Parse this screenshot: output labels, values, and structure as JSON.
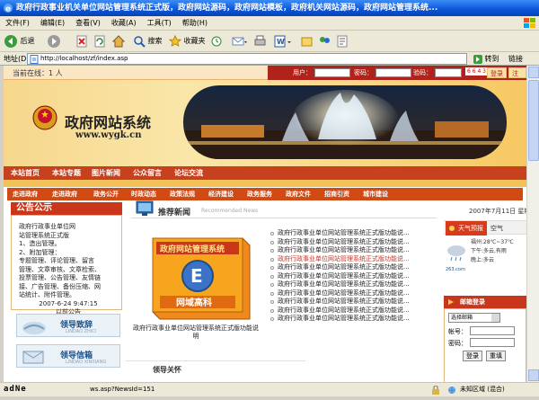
{
  "window": {
    "title": "政府行政事业机关单位网站管理系统正式版，政府网站源码，政府网站模板，政府机关网站源码，政府网站管理系统..."
  },
  "menu": [
    "文件(F)",
    "编辑(E)",
    "查看(V)",
    "收藏(A)",
    "工具(T)",
    "帮助(H)"
  ],
  "toolbar": {
    "back": "后退",
    "search": "搜索",
    "favorites": "收藏夹"
  },
  "address": {
    "label": "地址(D)",
    "url": "http://localhost/zf/index.asp",
    "go": "转到",
    "links": "链接"
  },
  "status": {
    "text": "ws.asp?NewsId=151",
    "zone": "未知区域 (混合)"
  },
  "page": {
    "online_label": "当前在线：1 人",
    "login": {
      "user_label": "用户：",
      "pass_label": "密码：",
      "code_label": "验码：",
      "code_value": "6 6 4 3",
      "login_btn": "登录",
      "register_btn": "注册"
    },
    "banner": {
      "title": "政府网站系统",
      "url": "www.wygk.cn"
    },
    "nav1": [
      "本站首页",
      "本站专题",
      "图片新闻",
      "公众留言",
      "论坛交流"
    ],
    "nav3": [
      "走进政府",
      "走进政府",
      "政务公开",
      "时政动态",
      "政策法规",
      "经济建设",
      "政务服务",
      "政府文件",
      "招商引资",
      "城市建设"
    ],
    "notice": {
      "title": "公告公示",
      "lines": [
        "政府行政事业单位网",
        "站管理系统正式版",
        "1、造出管理。",
        "2、附加管理：",
        "专题管理、评论管理、留言",
        "管理、文章审核、文章检索、",
        "投票管理、公告管理、友情链",
        "接、广告管理、备份压缩、网",
        "站统计、附件管理。",
        "2007-6-24 9:47:15",
        "以前公告"
      ]
    },
    "lead1": {
      "label": "领导致辞",
      "en": "LINDAO ZHICI"
    },
    "lead2": {
      "label": "领导信箱",
      "en": "LINDAO XINXIANG"
    },
    "featured": {
      "title": "推荐新闻",
      "en": "Recommended News",
      "product_title": "政府网站管理系统",
      "product_sub": "网域高科",
      "caption": "政府行政事业单位网站管理系统正式版功能说明"
    },
    "news": [
      "政府行政事业单位网站管理系统正式版功能说...",
      "政府行政事业单位网站管理系统正式版功能说...",
      "政府行政事业单位网站管理系统正式版功能说...",
      "政府行政事业单位网站管理系统正式版功能说...",
      "政府行政事业单位网站管理系统正式版功能说...",
      "政府行政事业单位网站管理系统正式版功能说...",
      "政府行政事业单位网站管理系统正式版功能说...",
      "政府行政事业单位网站管理系统正式版功能说...",
      "政府行政事业单位网站管理系统正式版功能说...",
      "政府行政事业单位网站管理系统正式版功能说...",
      "政府行政事业单位网站管理系统正式版功能说..."
    ],
    "date": "2007年7月11日 星期",
    "weather": {
      "tab1": "天气预报",
      "tab2": "空气",
      "city": "福州:28℃~37℃",
      "afternoon": "下午:多云,有雨",
      "night": "晚上:多云",
      "source": "263.com"
    },
    "mail": {
      "title": "邮箱登录",
      "select": "选择邮箱",
      "account": "帐号：",
      "password": "密码：",
      "login": "登录",
      "reset": "重填"
    },
    "leaders_caption": "领导关怀"
  }
}
